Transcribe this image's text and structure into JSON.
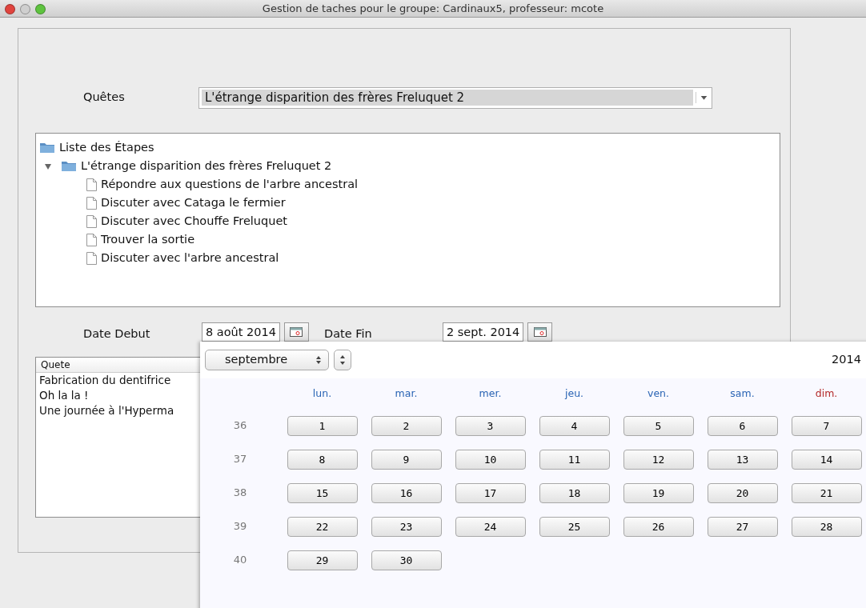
{
  "window": {
    "title": "Gestion de taches pour le groupe: Cardinaux5, professeur: mcote"
  },
  "quetes": {
    "label": "Quêtes",
    "value": "L'étrange disparition des frères Freluquet 2"
  },
  "tree": {
    "label": "Liste des Étapes",
    "children": [
      {
        "label": "L'étrange disparition des frères Freluquet 2",
        "expanded": true,
        "children": [
          {
            "label": "Répondre aux questions de l'arbre ancestral"
          },
          {
            "label": "Discuter avec Cataga le fermier"
          },
          {
            "label": "Discuter avec Chouffe Freluquet"
          },
          {
            "label": "Trouver la sortie"
          },
          {
            "label": "Discuter avec l'arbre ancestral"
          }
        ]
      }
    ]
  },
  "dates": {
    "start_label": "Date Debut",
    "start_value": "8 août 2014",
    "end_label": "Date Fin",
    "end_value": "2 sept. 2014"
  },
  "table": {
    "columns": [
      "Quete"
    ],
    "rows": [
      {
        "quete": "Fabrication du dentifrice"
      },
      {
        "quete": "Oh la la !"
      },
      {
        "quete": "Une journée à l'Hyperma"
      }
    ]
  },
  "calendar": {
    "month": "septembre",
    "year": "2014",
    "weekdays": [
      {
        "label": "lun.",
        "color": "#2a64b4"
      },
      {
        "label": "mar.",
        "color": "#2a64b4"
      },
      {
        "label": "mer.",
        "color": "#2a64b4"
      },
      {
        "label": "jeu.",
        "color": "#2a64b4"
      },
      {
        "label": "ven.",
        "color": "#2a64b4"
      },
      {
        "label": "sam.",
        "color": "#2a64b4"
      },
      {
        "label": "dim.",
        "color": "#b42a2a"
      }
    ],
    "weeks": [
      {
        "number": "36",
        "days": [
          "1",
          "2",
          "3",
          "4",
          "5",
          "6",
          "7"
        ]
      },
      {
        "number": "37",
        "days": [
          "8",
          "9",
          "10",
          "11",
          "12",
          "13",
          "14"
        ]
      },
      {
        "number": "38",
        "days": [
          "15",
          "16",
          "17",
          "18",
          "19",
          "20",
          "21"
        ]
      },
      {
        "number": "39",
        "days": [
          "22",
          "23",
          "24",
          "25",
          "26",
          "27",
          "28"
        ]
      },
      {
        "number": "40",
        "days": [
          "29",
          "30"
        ]
      }
    ]
  }
}
